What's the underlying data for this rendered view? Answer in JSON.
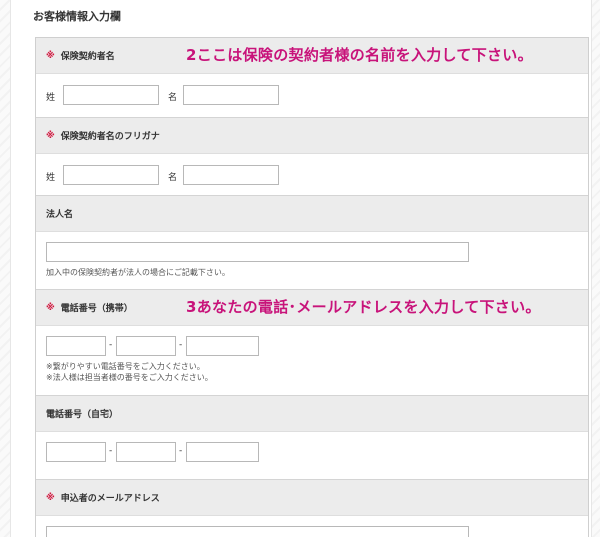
{
  "section_title": "お客様情報入力欄",
  "rows": {
    "contract_name": {
      "required_mark": "※",
      "label": "保険契約者名",
      "annotation": "2ここは保険の契約者様の名前を入力して下さい。",
      "last_label": "姓",
      "first_label": "名"
    },
    "furigana": {
      "required_mark": "※",
      "label": "保険契約者名のフリガナ",
      "last_label": "姓",
      "first_label": "名"
    },
    "company": {
      "label": "法人名",
      "note": "加入中の保険契約者が法人の場合にご記載下さい。"
    },
    "mobile": {
      "required_mark": "※",
      "label": "電話番号（携帯）",
      "annotation": "3あなたの電話･メールアドレスを入力して下さい。",
      "separator": "-",
      "note1": "※繋がりやすい電話番号をご入力ください。",
      "note2": "※法人様は担当者様の番号をご入力ください。"
    },
    "home_phone": {
      "label": "電話番号（自宅）",
      "separator": "-"
    },
    "email": {
      "required_mark": "※",
      "label": "申込者のメールアドレス"
    }
  }
}
